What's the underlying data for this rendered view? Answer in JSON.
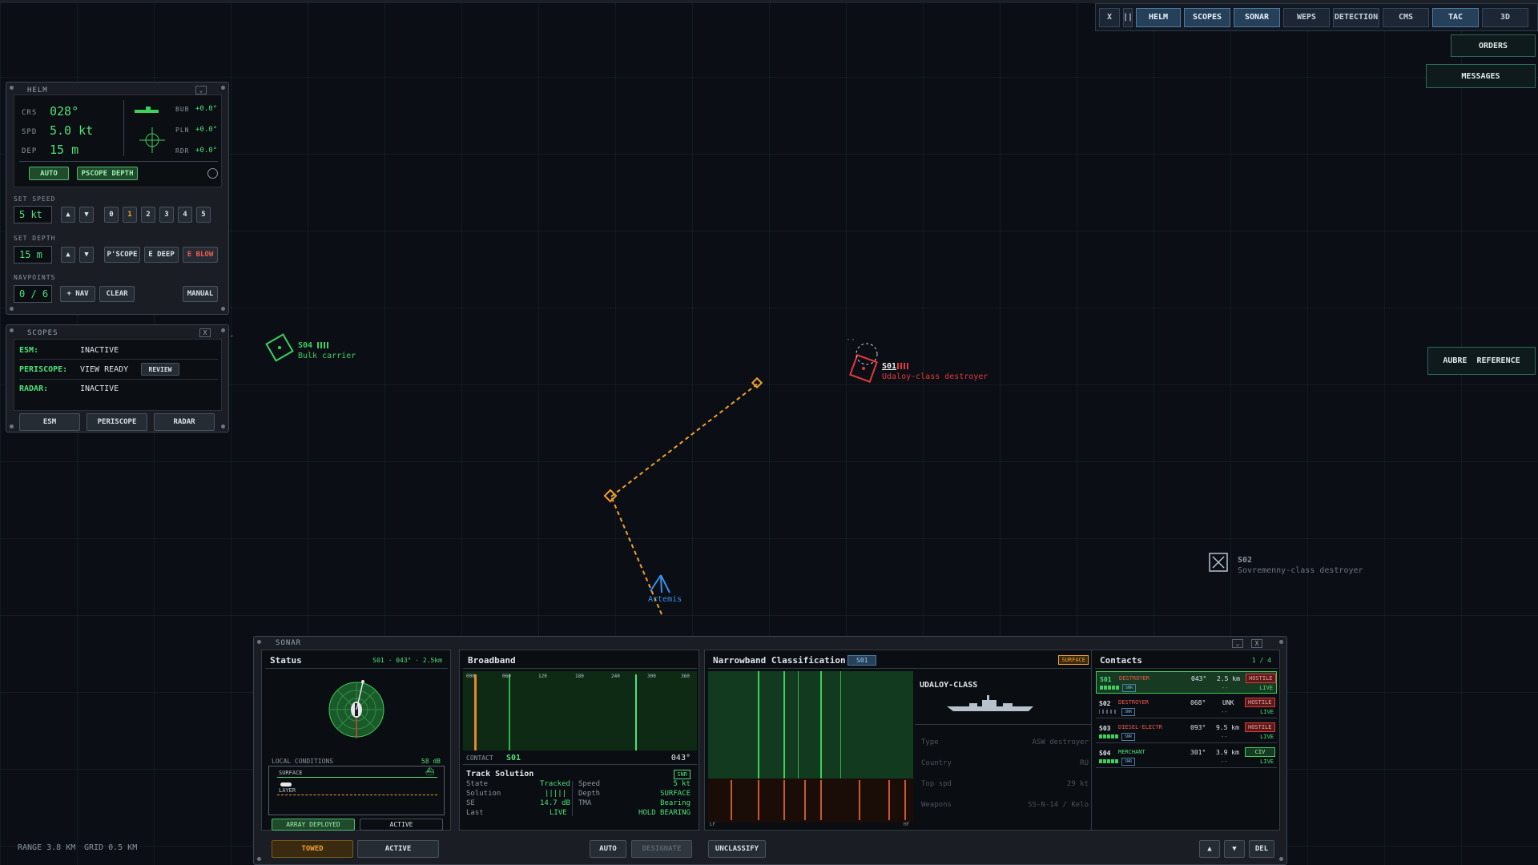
{
  "topnav": {
    "buttons": [
      "X",
      "||",
      "HELM",
      "SCOPES",
      "SONAR",
      "WEPS",
      "DETECTION",
      "CMS",
      "TAC",
      "3D"
    ]
  },
  "side": {
    "orders": "ORDERS",
    "messages": "MESSAGES",
    "aubre": "AUBRE",
    "reference": "REFERENCE"
  },
  "helm": {
    "title": "HELM",
    "crs_label": "CRS",
    "crs": "028°",
    "spd_label": "SPD",
    "spd": "5.0 kt",
    "dep_label": "DEP",
    "dep": "15 m",
    "bub_label": "BUB",
    "bub": "+0.0°",
    "pln_label": "PLN",
    "pln": "+0.0°",
    "rdr_label": "RDR",
    "rdr": "+0.0°",
    "auto": "AUTO",
    "pscope_depth": "PSCOPE DEPTH",
    "set_speed_label": "SET SPEED",
    "set_speed": "5 kt",
    "up": "▲",
    "down": "▼",
    "speeds": [
      "0",
      "1",
      "2",
      "3",
      "4",
      "5"
    ],
    "set_depth_label": "SET DEPTH",
    "set_depth": "15 m",
    "pscope": "P'SCOPE",
    "edeep": "E DEEP",
    "eblow": "E BLOW",
    "navpoints_label": "NAVPOINTS",
    "navpoints": "0 / 6",
    "addnav": "+ NAV",
    "clear": "CLEAR",
    "manual": "MANUAL"
  },
  "scopes": {
    "title": "SCOPES",
    "close": "X",
    "esm_label": "ESM:",
    "esm": "INACTIVE",
    "peri_label": "PERISCOPE:",
    "peri": "VIEW READY",
    "review": "REVIEW",
    "radar_label": "RADAR:",
    "radar": "INACTIVE",
    "btn_esm": "ESM",
    "btn_peri": "PERISCOPE",
    "btn_radar": "RADAR"
  },
  "map": {
    "s04_id": "S04",
    "s04_name": "Bulk carrier",
    "s01_id": "S01",
    "s01_name": "Udaloy-class destroyer",
    "s02_id": "S02",
    "s02_name": "Sovremenny-class destroyer",
    "own_name": "Artemis",
    "range": "RANGE 3.8 KM",
    "grid": "GRID 0.5 KM"
  },
  "sonar": {
    "title": "SONAR",
    "status_title": "Status",
    "status_info": "S01 · 043° · 2.5km",
    "local_conditions": "LOCAL CONDITIONS",
    "noise": "58 dB",
    "surface": "SURFACE",
    "layer": "LAYER",
    "array_deployed": "ARRAY DEPLOYED",
    "active": "ACTIVE",
    "broadband_title": "Broadband",
    "bb_ticks": [
      "000",
      "060",
      "120",
      "180",
      "240",
      "300",
      "360"
    ],
    "contact_label": "CONTACT",
    "contact": "S01",
    "contact_brg": "043°",
    "tracked_tag": "SNR",
    "track_title": "Track Solution",
    "track_left": [
      [
        "State",
        "Tracked"
      ],
      [
        "Solution",
        "|||||"
      ],
      [
        "SE",
        "14.7 dB"
      ],
      [
        "Last",
        "LIVE"
      ]
    ],
    "track_right": [
      [
        "Speed",
        "5 kt"
      ],
      [
        "Depth",
        "SURFACE"
      ],
      [
        "TMA",
        "Bearing"
      ],
      [
        "",
        "HOLD BEARING"
      ]
    ],
    "nb_title": "Narrowband Classification",
    "nb_tag": "S01",
    "nb_surface": "SURFACE",
    "nb_class": "UDALOY-CLASS",
    "lf": "LF",
    "hf": "HF",
    "nb_fields": [
      [
        "Type",
        "ASW destroyer"
      ],
      [
        "Country",
        "RU"
      ],
      [
        "Top spd",
        "29 kt"
      ],
      [
        "Weapons",
        "SS-N-14 / Kelo"
      ]
    ],
    "contacts_title": "Contacts",
    "contacts_count": "1 / 4",
    "contacts": [
      {
        "id": "S01",
        "type": "DESTROYER",
        "brg": "043°",
        "rng": "2.5 km",
        "iff": "HOSTILE",
        "sub": "--",
        "status": "LIVE",
        "sel": true
      },
      {
        "id": "S02",
        "type": "DESTROYER",
        "brg": "068°",
        "rng": "UNK",
        "iff": "HOSTILE",
        "sub": "--",
        "status": "LIVE",
        "sel": false
      },
      {
        "id": "S03",
        "type": "DIESEL-ELECTR",
        "brg": "093°",
        "rng": "9.5 km",
        "iff": "HOSTILE",
        "sub": "--",
        "status": "LIVE",
        "sel": false
      },
      {
        "id": "S04",
        "type": "MERCHANT",
        "brg": "301°",
        "rng": "3.9 km",
        "iff": "CIV",
        "sub": "--",
        "status": "LIVE",
        "sel": false
      }
    ],
    "towed": "TOWED",
    "active_btn": "ACTIVE",
    "auto": "AUTO",
    "designate": "DESIGNATE",
    "unclassify": "UNCLASSIFY",
    "up": "▲",
    "down": "▼",
    "del": "DEL"
  }
}
